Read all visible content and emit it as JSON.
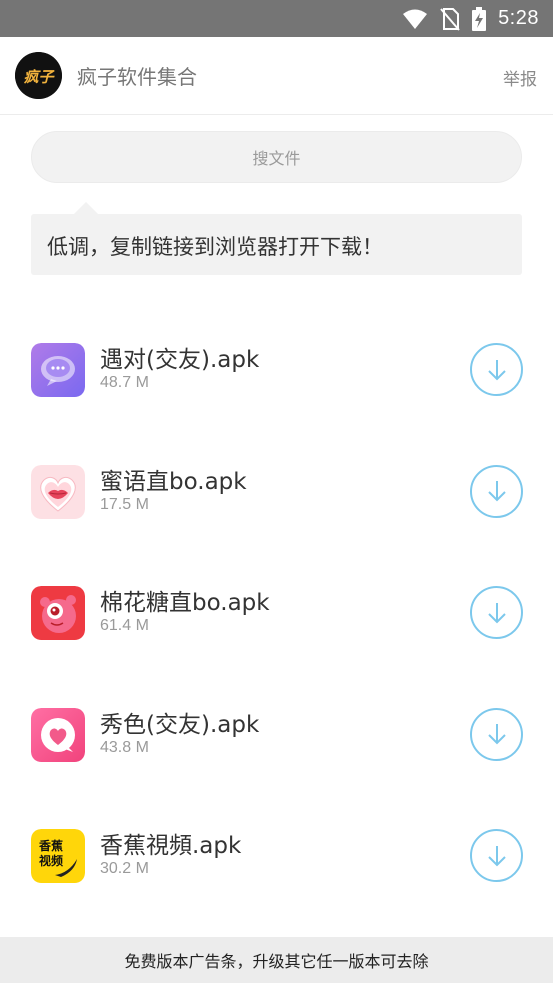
{
  "status_bar": {
    "time": "5:28",
    "icons": [
      "wifi-icon",
      "no-sim-icon",
      "battery-charging-icon"
    ]
  },
  "header": {
    "logo_text": "疯子",
    "title": "疯子软件集合",
    "report_label": "举报"
  },
  "search": {
    "placeholder": "搜文件"
  },
  "notice": {
    "text": "低调，复制链接到浏览器打开下载！"
  },
  "files": [
    {
      "name": "遇对(交友).apk",
      "size": "48.7 M",
      "icon": "chat-bubble-app-icon"
    },
    {
      "name": "蜜语直bo.apk",
      "size": "17.5 M",
      "icon": "heart-lips-app-icon"
    },
    {
      "name": "棉花糖直bo.apk",
      "size": "61.4 M",
      "icon": "red-monster-app-icon"
    },
    {
      "name": "秀色(交友).apk",
      "size": "43.8 M",
      "icon": "pink-heart-app-icon"
    },
    {
      "name": "香蕉視頻.apk",
      "size": "30.2 M",
      "icon": "banana-video-app-icon",
      "icon_text_1": "香蕉",
      "icon_text_2": "视频"
    }
  ],
  "ad_bar": {
    "text": "免费版本广告条，升级其它任一版本可去除"
  },
  "colors": {
    "status_bar": "#757575",
    "download_accent": "#7cc8ec",
    "notice_bg": "#f2f2f2"
  }
}
